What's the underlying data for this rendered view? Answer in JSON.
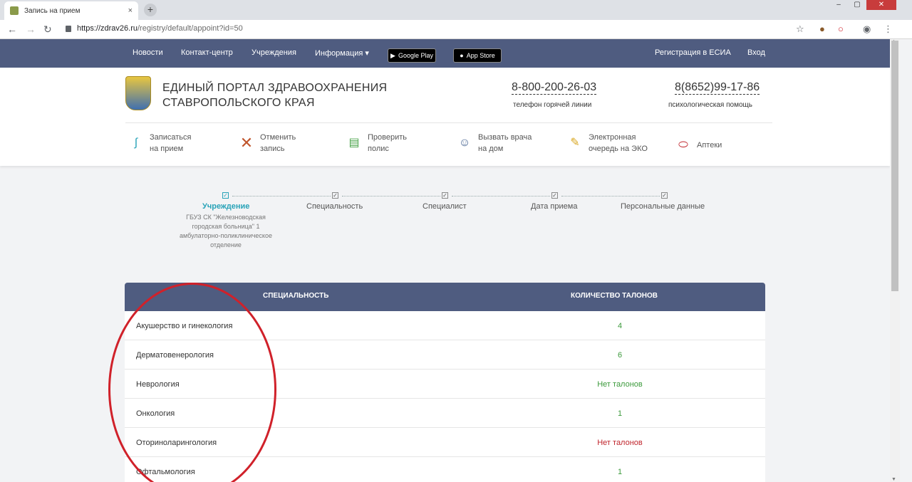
{
  "browser": {
    "tab_title": "Запись на прием",
    "tab_close": "×",
    "new_tab": "+",
    "url_host": "https://zdrav26.ru",
    "url_path": "/registry/default/appoint?id=50",
    "ghost_tabs": [
      "",
      "",
      "",
      ""
    ]
  },
  "site_nav": {
    "items": [
      "Новости",
      "Контакт-центр",
      "Учреждения",
      "Информация ▾"
    ],
    "google_play": "Google Play",
    "app_store": "App Store",
    "register": "Регистрация в ЕСИА",
    "login": "Вход"
  },
  "header": {
    "title_line1": "ЕДИНЫЙ ПОРТАЛ ЗДРАВООХРАНЕНИЯ",
    "title_line2": "СТАВРОПОЛЬСКОГО КРАЯ",
    "phone1": "8-800-200-26-03",
    "phone1_caption": "телефон горячей линии",
    "phone2": "8(8652)99-17-86",
    "phone2_caption": "психологическая помощь"
  },
  "services": [
    {
      "line1": "Записаться",
      "line2": "на прием",
      "icon": "stethoscope-icon"
    },
    {
      "line1": "Отменить",
      "line2": "запись",
      "icon": "cross-icon"
    },
    {
      "line1": "Проверить",
      "line2": "полис",
      "icon": "clipboard-icon"
    },
    {
      "line1": "Вызвать врача",
      "line2": "на дом",
      "icon": "doctor-icon"
    },
    {
      "line1": "Электронная",
      "line2": "очередь на ЭКО",
      "icon": "queue-icon"
    },
    {
      "line1": "Аптеки",
      "line2": "",
      "icon": "pill-icon"
    }
  ],
  "steps": {
    "labels": [
      "Учреждение",
      "Специальность",
      "Специалист",
      "Дата приема",
      "Персональные данные"
    ],
    "detail": "ГБУЗ СК \"Железноводская городская больница\" 1 амбулаторно-поликлиническое отделение"
  },
  "table": {
    "col_specialty": "СПЕЦИАЛЬНОСТЬ",
    "col_count": "КОЛИЧЕСТВО ТАЛОНОВ",
    "rows": [
      {
        "name": "Акушерство и гинекология",
        "count": "4",
        "color": "#3c9a3c"
      },
      {
        "name": "Дерматовенерология",
        "count": "6",
        "color": "#3c9a3c"
      },
      {
        "name": "Неврология",
        "count": "Нет талонов",
        "color": "#3c9a3c"
      },
      {
        "name": "Онкология",
        "count": "1",
        "color": "#3c9a3c"
      },
      {
        "name": "Оториноларингология",
        "count": "Нет талонов",
        "color": "#c0262d"
      },
      {
        "name": "Офтальмология",
        "count": "1",
        "color": "#3c9a3c"
      }
    ]
  },
  "colors": {
    "nav": "#4f5c80",
    "accent": "#29a3b8",
    "annotation": "#d0212a"
  }
}
